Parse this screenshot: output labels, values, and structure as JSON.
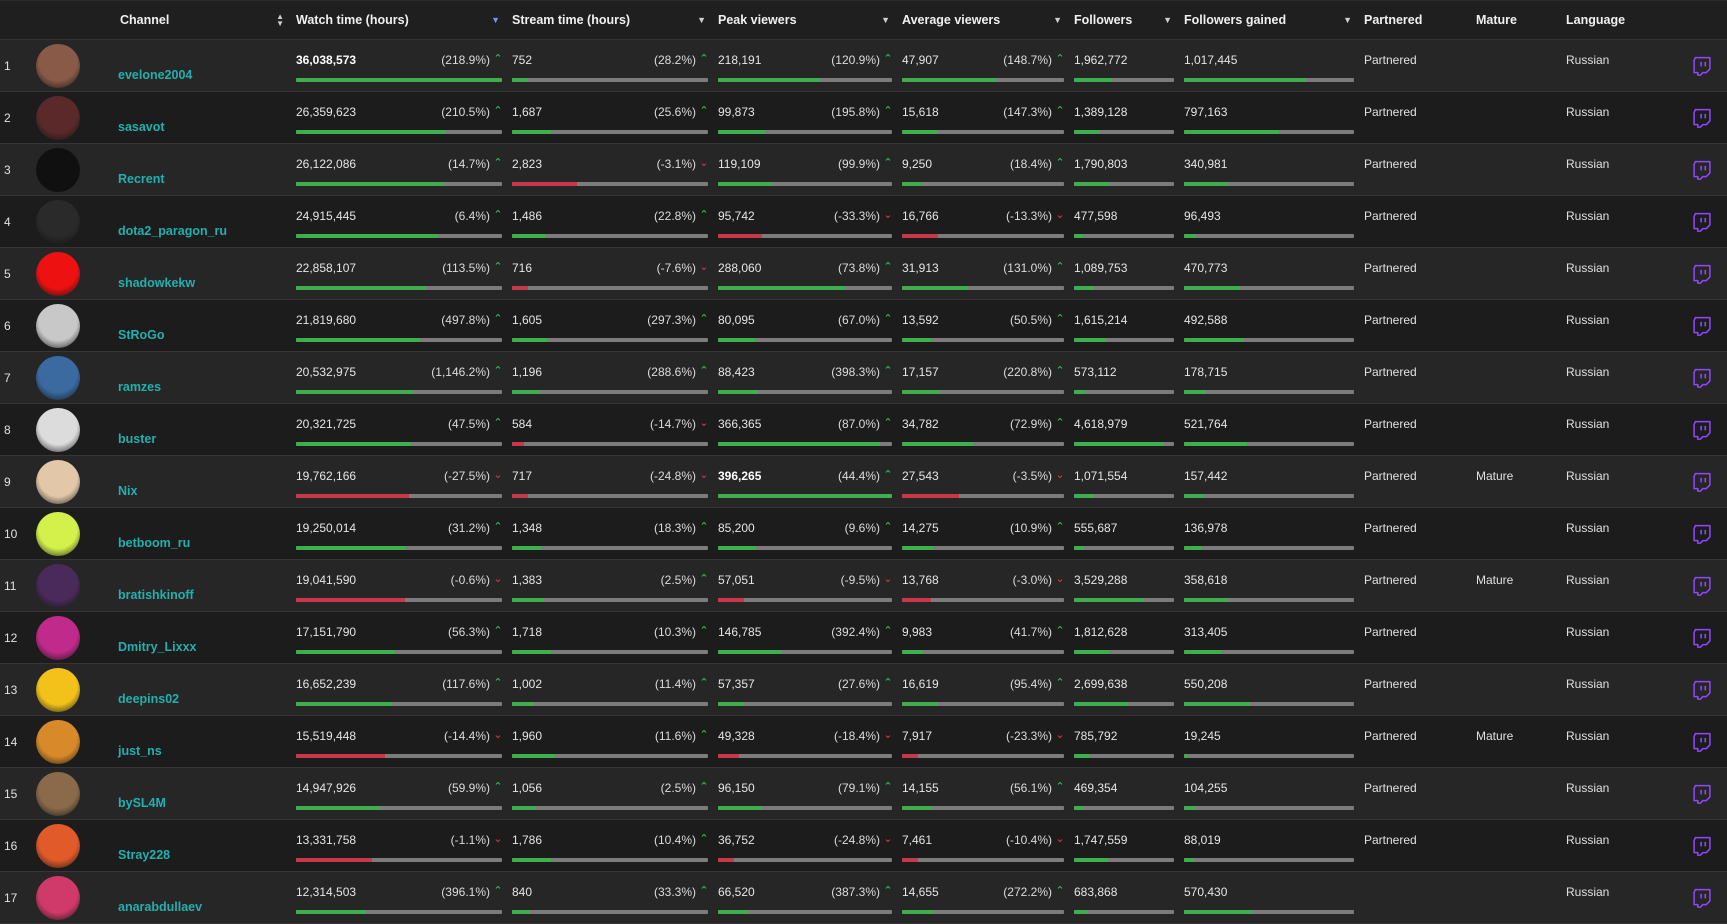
{
  "headers": {
    "channel": "Channel",
    "watch": "Watch time (hours)",
    "stream": "Stream time (hours)",
    "peak": "Peak viewers",
    "avg": "Average viewers",
    "followers": "Followers",
    "gained": "Followers gained",
    "partnered": "Partnered",
    "mature": "Mature",
    "language": "Language"
  },
  "colors": {
    "channel_link": "#21b0ae",
    "positive": "#3cc85a",
    "negative": "#e23b4b",
    "twitch_icon": "#9146ff",
    "sort_active": "#7a8cff"
  },
  "icons": {
    "row_action": "twitch-icon",
    "trend_up": "caret-up-icon",
    "trend_down": "caret-down-icon"
  },
  "rows": [
    {
      "rank": "1",
      "name": "evelone2004",
      "watch": "36,038,573",
      "watch_pct": "(218.9%)",
      "watch_dir": "up",
      "watch_bar": 1.0,
      "stream": "752",
      "stream_pct": "(28.2%)",
      "stream_dir": "up",
      "stream_bar": 0.08,
      "peak": "218,191",
      "peak_pct": "(120.9%)",
      "peak_dir": "up",
      "peak_bar": 0.58,
      "avg": "47,907",
      "avg_pct": "(148.7%)",
      "avg_dir": "up",
      "avg_bar": 0.58,
      "followers": "1,962,772",
      "followers_bar": 0.38,
      "gained": "1,017,445",
      "gained_bar": 0.72,
      "partnered": "Partnered",
      "mature": "",
      "language": "Russian",
      "avatar_color": "#8a5a48"
    },
    {
      "rank": "2",
      "name": "sasavot",
      "watch": "26,359,623",
      "watch_pct": "(210.5%)",
      "watch_dir": "up",
      "watch_bar": 0.73,
      "stream": "1,687",
      "stream_pct": "(25.6%)",
      "stream_dir": "up",
      "stream_bar": 0.2,
      "peak": "99,873",
      "peak_pct": "(195.8%)",
      "peak_dir": "up",
      "peak_bar": 0.27,
      "avg": "15,618",
      "avg_pct": "(147.3%)",
      "avg_dir": "up",
      "avg_bar": 0.22,
      "followers": "1,389,128",
      "followers_bar": 0.26,
      "gained": "797,163",
      "gained_bar": 0.56,
      "partnered": "Partnered",
      "mature": "",
      "language": "Russian",
      "avatar_color": "#5a2a2a"
    },
    {
      "rank": "3",
      "name": "Recrent",
      "watch": "26,122,086",
      "watch_pct": "(14.7%)",
      "watch_dir": "up",
      "watch_bar": 0.72,
      "stream": "2,823",
      "stream_pct": "(-3.1%)",
      "stream_dir": "down",
      "stream_bar": 0.33,
      "peak": "119,109",
      "peak_pct": "(99.9%)",
      "peak_dir": "up",
      "peak_bar": 0.31,
      "avg": "9,250",
      "avg_pct": "(18.4%)",
      "avg_dir": "up",
      "avg_bar": 0.12,
      "followers": "1,790,803",
      "followers_bar": 0.35,
      "gained": "340,981",
      "gained_bar": 0.25,
      "partnered": "Partnered",
      "mature": "",
      "language": "Russian",
      "avatar_color": "#101010"
    },
    {
      "rank": "4",
      "name": "dota2_paragon_ru",
      "watch": "24,915,445",
      "watch_pct": "(6.4%)",
      "watch_dir": "up",
      "watch_bar": 0.69,
      "stream": "1,486",
      "stream_pct": "(22.8%)",
      "stream_dir": "up",
      "stream_bar": 0.17,
      "peak": "95,742",
      "peak_pct": "(-33.3%)",
      "peak_dir": "down",
      "peak_bar": 0.25,
      "avg": "16,766",
      "avg_pct": "(-13.3%)",
      "avg_dir": "down",
      "avg_bar": 0.22,
      "followers": "477,598",
      "followers_bar": 0.09,
      "gained": "96,493",
      "gained_bar": 0.07,
      "partnered": "Partnered",
      "mature": "",
      "language": "Russian",
      "avatar_color": "#2a2a2a"
    },
    {
      "rank": "5",
      "name": "shadowkekw",
      "watch": "22,858,107",
      "watch_pct": "(113.5%)",
      "watch_dir": "up",
      "watch_bar": 0.63,
      "stream": "716",
      "stream_pct": "(-7.6%)",
      "stream_dir": "down",
      "stream_bar": 0.08,
      "peak": "288,060",
      "peak_pct": "(73.8%)",
      "peak_dir": "up",
      "peak_bar": 0.73,
      "avg": "31,913",
      "avg_pct": "(131.0%)",
      "avg_dir": "up",
      "avg_bar": 0.4,
      "followers": "1,089,753",
      "followers_bar": 0.2,
      "gained": "470,773",
      "gained_bar": 0.33,
      "partnered": "Partnered",
      "mature": "",
      "language": "Russian",
      "avatar_color": "#ee1111"
    },
    {
      "rank": "6",
      "name": "StRoGo",
      "watch": "21,819,680",
      "watch_pct": "(497.8%)",
      "watch_dir": "up",
      "watch_bar": 0.6,
      "stream": "1,605",
      "stream_pct": "(297.3%)",
      "stream_dir": "up",
      "stream_bar": 0.18,
      "peak": "80,095",
      "peak_pct": "(67.0%)",
      "peak_dir": "up",
      "peak_bar": 0.21,
      "avg": "13,592",
      "avg_pct": "(50.5%)",
      "avg_dir": "up",
      "avg_bar": 0.18,
      "followers": "1,615,214",
      "followers_bar": 0.32,
      "gained": "492,588",
      "gained_bar": 0.35,
      "partnered": "Partnered",
      "mature": "",
      "language": "Russian",
      "avatar_color": "#c8c8c8"
    },
    {
      "rank": "7",
      "name": "ramzes",
      "watch": "20,532,975",
      "watch_pct": "(1,146.2%)",
      "watch_dir": "up",
      "watch_bar": 0.57,
      "stream": "1,196",
      "stream_pct": "(288.6%)",
      "stream_dir": "up",
      "stream_bar": 0.14,
      "peak": "88,423",
      "peak_pct": "(398.3%)",
      "peak_dir": "up",
      "peak_bar": 0.23,
      "avg": "17,157",
      "avg_pct": "(220.8%)",
      "avg_dir": "up",
      "avg_bar": 0.23,
      "followers": "573,112",
      "followers_bar": 0.11,
      "gained": "178,715",
      "gained_bar": 0.13,
      "partnered": "Partnered",
      "mature": "",
      "language": "Russian",
      "avatar_color": "#3a6aa0"
    },
    {
      "rank": "8",
      "name": "buster",
      "watch": "20,321,725",
      "watch_pct": "(47.5%)",
      "watch_dir": "up",
      "watch_bar": 0.56,
      "stream": "584",
      "stream_pct": "(-14.7%)",
      "stream_dir": "down",
      "stream_bar": 0.06,
      "peak": "366,365",
      "peak_pct": "(87.0%)",
      "peak_dir": "up",
      "peak_bar": 0.93,
      "avg": "34,782",
      "avg_pct": "(72.9%)",
      "avg_dir": "up",
      "avg_bar": 0.44,
      "followers": "4,618,979",
      "followers_bar": 0.9,
      "gained": "521,764",
      "gained_bar": 0.37,
      "partnered": "Partnered",
      "mature": "",
      "language": "Russian",
      "avatar_color": "#dcdcdc"
    },
    {
      "rank": "9",
      "name": "Nix",
      "watch": "19,762,166",
      "watch_pct": "(-27.5%)",
      "watch_dir": "down",
      "watch_bar": 0.55,
      "stream": "717",
      "stream_pct": "(-24.8%)",
      "stream_dir": "down",
      "stream_bar": 0.08,
      "peak": "396,265",
      "peak_pct": "(44.4%)",
      "peak_dir": "up",
      "peak_bar": 1.0,
      "avg": "27,543",
      "avg_pct": "(-3.5%)",
      "avg_dir": "down",
      "avg_bar": 0.35,
      "followers": "1,071,554",
      "followers_bar": 0.2,
      "gained": "157,442",
      "gained_bar": 0.11,
      "partnered": "Partnered",
      "mature": "Mature",
      "language": "Russian",
      "avatar_color": "#e2c8a8"
    },
    {
      "rank": "10",
      "name": "betboom_ru",
      "watch": "19,250,014",
      "watch_pct": "(31.2%)",
      "watch_dir": "up",
      "watch_bar": 0.53,
      "stream": "1,348",
      "stream_pct": "(18.3%)",
      "stream_dir": "up",
      "stream_bar": 0.15,
      "peak": "85,200",
      "peak_pct": "(9.6%)",
      "peak_dir": "up",
      "peak_bar": 0.22,
      "avg": "14,275",
      "avg_pct": "(10.9%)",
      "avg_dir": "up",
      "avg_bar": 0.19,
      "followers": "555,687",
      "followers_bar": 0.1,
      "gained": "136,978",
      "gained_bar": 0.1,
      "partnered": "Partnered",
      "mature": "",
      "language": "Russian",
      "avatar_color": "#d4f04a"
    },
    {
      "rank": "11",
      "name": "bratishkinoff",
      "watch": "19,041,590",
      "watch_pct": "(-0.6%)",
      "watch_dir": "down",
      "watch_bar": 0.53,
      "stream": "1,383",
      "stream_pct": "(2.5%)",
      "stream_dir": "up",
      "stream_bar": 0.16,
      "peak": "57,051",
      "peak_pct": "(-9.5%)",
      "peak_dir": "down",
      "peak_bar": 0.15,
      "avg": "13,768",
      "avg_pct": "(-3.0%)",
      "avg_dir": "down",
      "avg_bar": 0.18,
      "followers": "3,529,288",
      "followers_bar": 0.69,
      "gained": "358,618",
      "gained_bar": 0.26,
      "partnered": "Partnered",
      "mature": "Mature",
      "language": "Russian",
      "avatar_color": "#4a2a5a"
    },
    {
      "rank": "12",
      "name": "Dmitry_Lixxx",
      "watch": "17,151,790",
      "watch_pct": "(56.3%)",
      "watch_dir": "up",
      "watch_bar": 0.48,
      "stream": "1,718",
      "stream_pct": "(10.3%)",
      "stream_dir": "up",
      "stream_bar": 0.2,
      "peak": "146,785",
      "peak_pct": "(392.4%)",
      "peak_dir": "up",
      "peak_bar": 0.37,
      "avg": "9,983",
      "avg_pct": "(41.7%)",
      "avg_dir": "up",
      "avg_bar": 0.13,
      "followers": "1,812,628",
      "followers_bar": 0.35,
      "gained": "313,405",
      "gained_bar": 0.22,
      "partnered": "Partnered",
      "mature": "",
      "language": "Russian",
      "avatar_color": "#c02a8a"
    },
    {
      "rank": "13",
      "name": "deepins02",
      "watch": "16,652,239",
      "watch_pct": "(117.6%)",
      "watch_dir": "up",
      "watch_bar": 0.46,
      "stream": "1,002",
      "stream_pct": "(11.4%)",
      "stream_dir": "up",
      "stream_bar": 0.11,
      "peak": "57,357",
      "peak_pct": "(27.6%)",
      "peak_dir": "up",
      "peak_bar": 0.15,
      "avg": "16,619",
      "avg_pct": "(95.4%)",
      "avg_dir": "up",
      "avg_bar": 0.22,
      "followers": "2,699,638",
      "followers_bar": 0.53,
      "gained": "550,208",
      "gained_bar": 0.39,
      "partnered": "Partnered",
      "mature": "",
      "language": "Russian",
      "avatar_color": "#f2c21a"
    },
    {
      "rank": "14",
      "name": "just_ns",
      "watch": "15,519,448",
      "watch_pct": "(-14.4%)",
      "watch_dir": "down",
      "watch_bar": 0.43,
      "stream": "1,960",
      "stream_pct": "(11.6%)",
      "stream_dir": "up",
      "stream_bar": 0.22,
      "peak": "49,328",
      "peak_pct": "(-18.4%)",
      "peak_dir": "down",
      "peak_bar": 0.12,
      "avg": "7,917",
      "avg_pct": "(-23.3%)",
      "avg_dir": "down",
      "avg_bar": 0.1,
      "followers": "785,792",
      "followers_bar": 0.15,
      "gained": "19,245",
      "gained_bar": 0.02,
      "partnered": "Partnered",
      "mature": "Mature",
      "language": "Russian",
      "avatar_color": "#d88a2a"
    },
    {
      "rank": "15",
      "name": "bySL4M",
      "watch": "14,947,926",
      "watch_pct": "(59.9%)",
      "watch_dir": "up",
      "watch_bar": 0.41,
      "stream": "1,056",
      "stream_pct": "(2.5%)",
      "stream_dir": "up",
      "stream_bar": 0.12,
      "peak": "96,150",
      "peak_pct": "(79.1%)",
      "peak_dir": "up",
      "peak_bar": 0.25,
      "avg": "14,155",
      "avg_pct": "(56.1%)",
      "avg_dir": "up",
      "avg_bar": 0.18,
      "followers": "469,354",
      "followers_bar": 0.09,
      "gained": "104,255",
      "gained_bar": 0.07,
      "partnered": "Partnered",
      "mature": "",
      "language": "Russian",
      "avatar_color": "#8a6a4a"
    },
    {
      "rank": "16",
      "name": "Stray228",
      "watch": "13,331,758",
      "watch_pct": "(-1.1%)",
      "watch_dir": "down",
      "watch_bar": 0.37,
      "stream": "1,786",
      "stream_pct": "(10.4%)",
      "stream_dir": "up",
      "stream_bar": 0.2,
      "peak": "36,752",
      "peak_pct": "(-24.8%)",
      "peak_dir": "down",
      "peak_bar": 0.09,
      "avg": "7,461",
      "avg_pct": "(-10.4%)",
      "avg_dir": "down",
      "avg_bar": 0.1,
      "followers": "1,747,559",
      "followers_bar": 0.34,
      "gained": "88,019",
      "gained_bar": 0.06,
      "partnered": "Partnered",
      "mature": "",
      "language": "Russian",
      "avatar_color": "#e05a2a"
    },
    {
      "rank": "17",
      "name": "anarabdullaev",
      "watch": "12,314,503",
      "watch_pct": "(396.1%)",
      "watch_dir": "up",
      "watch_bar": 0.34,
      "stream": "840",
      "stream_pct": "(33.3%)",
      "stream_dir": "up",
      "stream_bar": 0.09,
      "peak": "66,520",
      "peak_pct": "(387.3%)",
      "peak_dir": "up",
      "peak_bar": 0.17,
      "avg": "14,655",
      "avg_pct": "(272.2%)",
      "avg_dir": "up",
      "avg_bar": 0.19,
      "followers": "683,868",
      "followers_bar": 0.13,
      "gained": "570,430",
      "gained_bar": 0.4,
      "partnered": "",
      "mature": "",
      "language": "Russian",
      "avatar_color": "#d03a6a"
    }
  ]
}
